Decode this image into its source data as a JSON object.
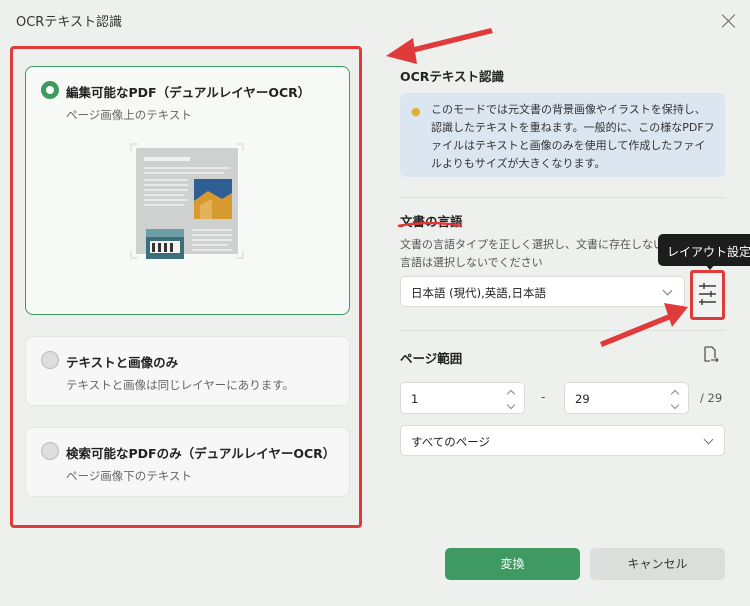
{
  "dialog": {
    "title": "OCRテキスト認識"
  },
  "modes": [
    {
      "title": "編集可能なPDF（デュアルレイヤーOCR）",
      "subtitle": "ページ画像上のテキスト",
      "selected": true
    },
    {
      "title": "テキストと画像のみ",
      "subtitle": "テキストと画像は同じレイヤーにあります。",
      "selected": false
    },
    {
      "title": "検索可能なPDFのみ（デュアルレイヤーOCR）",
      "subtitle": "ページ画像下のテキスト",
      "selected": false
    }
  ],
  "ocr_section": {
    "title": "OCRテキスト認識",
    "info": "このモードでは元文書の背景画像やイラストを保持し、認識したテキストを重ねます。一般的に、この様なPDFファイルはテキストと画像のみを使用して作成したファイルよりもサイズが大きくなります。"
  },
  "language_section": {
    "title": "文書の言語",
    "help": "文書の言語タイプを正しく選択し、文書に存在しない言語は選択しないでください",
    "selected_value": "日本語 (現代),英語,日本語",
    "settings_tooltip": "レイアウト設定"
  },
  "page_range": {
    "title": "ページ範囲",
    "from": "1",
    "separator": "-",
    "to": "29",
    "total": "/ 29",
    "preset": "すべてのページ"
  },
  "buttons": {
    "convert": "変換",
    "cancel": "キャンセル"
  },
  "colors": {
    "accent": "#3e9a62",
    "annotation_red": "#e03a3a",
    "info_bg": "#dbe6f1"
  }
}
